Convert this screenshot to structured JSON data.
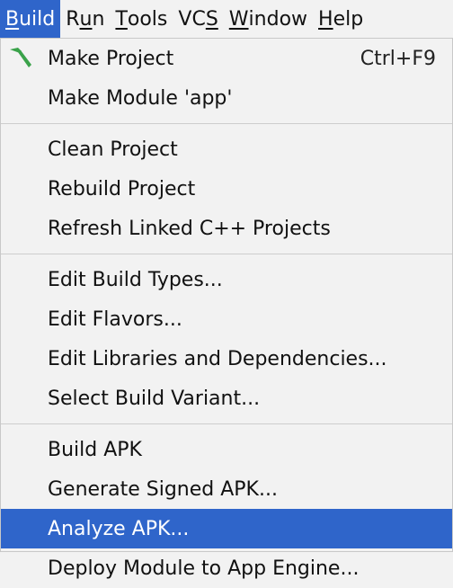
{
  "menubar": {
    "items": [
      {
        "pre": "",
        "mn": "B",
        "post": "uild"
      },
      {
        "pre": "R",
        "mn": "u",
        "post": "n"
      },
      {
        "pre": "",
        "mn": "T",
        "post": "ools"
      },
      {
        "pre": "VC",
        "mn": "S",
        "post": ""
      },
      {
        "pre": "",
        "mn": "W",
        "post": "indow"
      },
      {
        "pre": "",
        "mn": "H",
        "post": "elp"
      }
    ]
  },
  "menu": {
    "make_project": {
      "label": "Make Project",
      "shortcut": "Ctrl+F9",
      "icon": "hammer-icon"
    },
    "make_module": {
      "label": "Make Module 'app'"
    },
    "clean_project": {
      "label": "Clean Project"
    },
    "rebuild_project": {
      "label": "Rebuild Project"
    },
    "refresh_cpp": {
      "label": "Refresh Linked C++ Projects"
    },
    "edit_build_types": {
      "label": "Edit Build Types..."
    },
    "edit_flavors": {
      "label": "Edit Flavors..."
    },
    "edit_libraries": {
      "label": "Edit Libraries and Dependencies..."
    },
    "select_variant": {
      "label": "Select Build Variant..."
    },
    "build_apk": {
      "label": "Build APK"
    },
    "generate_signed": {
      "label": "Generate Signed APK..."
    },
    "analyze_apk": {
      "label": "Analyze APK..."
    },
    "deploy_module": {
      "label": "Deploy Module to App Engine..."
    }
  },
  "colors": {
    "accent": "#2f65ca",
    "menu_bg": "#f2f2f2",
    "separator": "#cdcdcd",
    "hammer": "#3aa24a"
  }
}
